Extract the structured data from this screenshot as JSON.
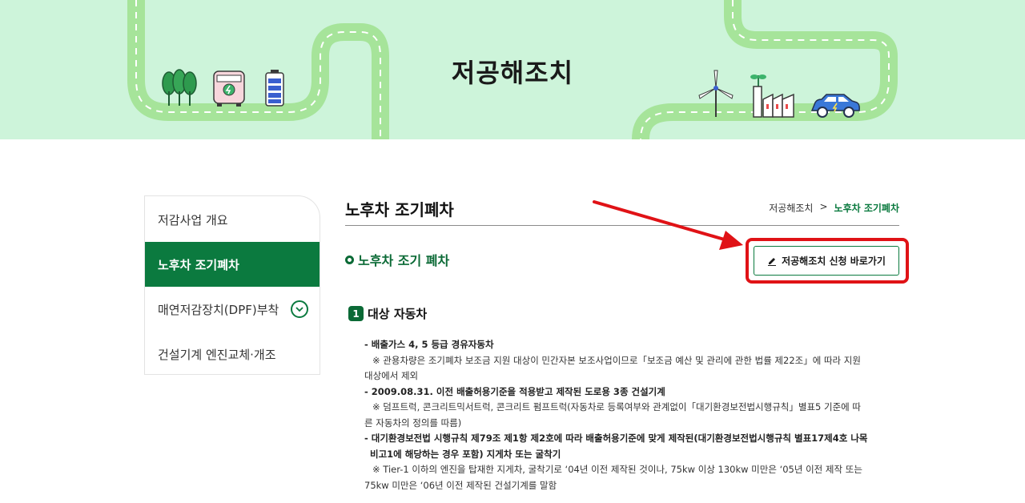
{
  "banner": {
    "title": "저공해조치"
  },
  "sidebar": {
    "items": [
      {
        "label": "저감사업 개요"
      },
      {
        "label": "노후차 조기폐차"
      },
      {
        "label": "매연저감장치(DPF)부착"
      },
      {
        "label": "건설기계 엔진교체·개조"
      }
    ]
  },
  "main": {
    "title": "노후차 조기폐차",
    "breadcrumb": {
      "parent": "저공해조치",
      "separator": ">",
      "current": "노후차 조기폐차"
    },
    "section_title": "노후차 조기 폐차",
    "apply_button": "저공해조치 신청 바로가기",
    "subsection": {
      "number": "1",
      "title": "대상 자동차"
    },
    "lines": [
      "- 배출가스 4, 5 등급 경유자동차",
      "※ 관용차량은 조기폐차 보조금 지원 대상이 민간자본 보조사업이므로「보조금 예산 및 관리에 관한 법률 제22조」에 따라 지원",
      "대상에서 제외",
      "- 2009.08.31. 이전 배출허용기준을 적용받고 제작된 도로용 3종 건설기계",
      "※ 덤프트럭, 콘크리트믹서트럭, 콘크리트 펌프트럭(자동차로 등록여부와 관계없이「대기환경보전법시행규칙」별표5 기준에 따",
      "른 자동차의 정의를 따름)",
      "- 대기환경보전법 시행규칙 제79조 제1항 제2호에 따라 배출허용기준에 맞게 제작된(대기환경보전법시행규칙 별표17제4호 나목",
      "비고1에 해당하는 경우 포함) 지게차 또는 굴착기",
      "※ Tier-1 이하의 엔진을 탑재한 지게차, 굴착기로 ‘04년 이전 제작된 것이나, 75kw 이상 130kw 미만은 ‘05년 이전 제작 또는",
      "75kw 미만은 ‘06년 이전 제작된 건설기계를 말함"
    ]
  },
  "colors": {
    "accent": "#0b7a3f",
    "banner_bg": "#cdf4da",
    "highlight": "#e01216"
  }
}
